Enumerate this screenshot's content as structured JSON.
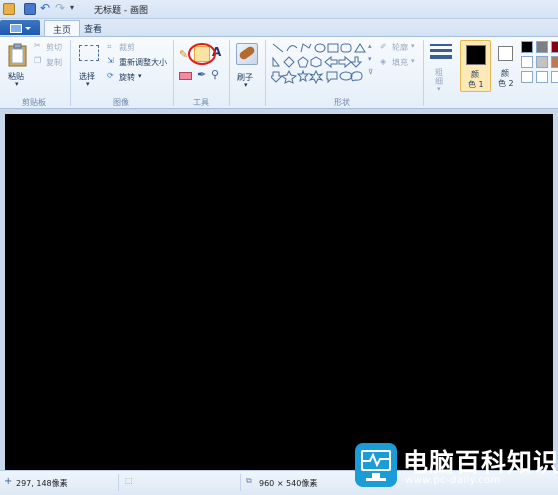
{
  "window": {
    "title": "无标题 - 画图"
  },
  "tabs": [
    {
      "label": "主页",
      "active": true
    },
    {
      "label": "查看",
      "active": false
    }
  ],
  "ribbon": {
    "clipboard": {
      "paste": "粘贴",
      "cut": "剪切",
      "copy": "复制",
      "group_label": "剪贴板"
    },
    "image": {
      "select": "选择",
      "crop": "裁剪",
      "resize": "重新调整大小",
      "rotate": "旋转",
      "group_label": "图像"
    },
    "tools": {
      "group_label": "工具"
    },
    "brushes": {
      "label": "刷子"
    },
    "shapes": {
      "outline": "轮廓",
      "fill": "填充",
      "group_label": "形状"
    },
    "size": {
      "label_line1": "粗",
      "label_line2": "细"
    },
    "color1": {
      "label_line1": "颜",
      "label_line2": "色 1",
      "value": "#000000"
    },
    "color2": {
      "label_line1": "颜",
      "label_line2": "色 2",
      "value": "#ffffff"
    },
    "palette": [
      "#000000",
      "#7f7f7f",
      "#880015",
      "#ffffff",
      "#c3c3c3",
      "#b97a57",
      "#ffffff",
      "#ffffff",
      "#ffffff"
    ]
  },
  "status": {
    "cursor_position": "297, 148像素",
    "image_size": "960 × 540像素"
  },
  "watermark": {
    "title": "电脑百科知识",
    "url": "www.pc-daily.com"
  }
}
